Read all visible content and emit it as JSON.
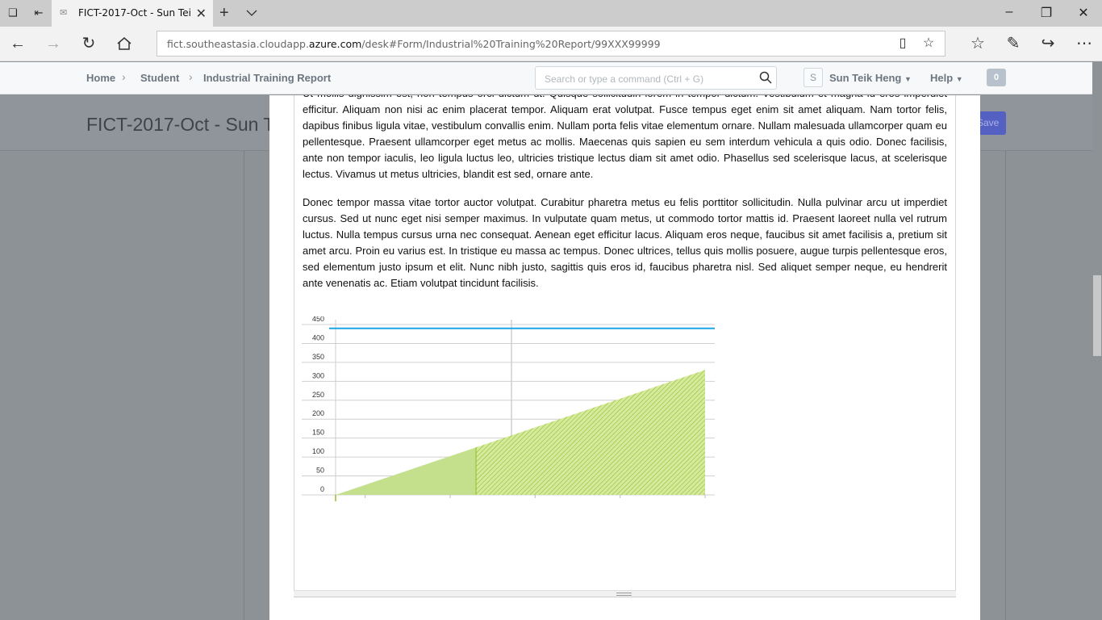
{
  "browser": {
    "tab_title": "FICT-2017-Oct - Sun Tei",
    "url_prefix": "fict.southeastasia.cloudapp.",
    "url_domain": "azure.com",
    "url_path": "/desk#Form/Industrial%20Training%20Report/99XXX99999"
  },
  "header": {
    "breadcrumbs": [
      "Home",
      "Student",
      "Industrial Training Report"
    ],
    "search_placeholder": "Search or type a command (Ctrl + G)",
    "avatar_initial": "S",
    "user_name": "Sun Teik Heng",
    "help_label": "Help",
    "notification_count": "0"
  },
  "background_page": {
    "title": "FICT-2017-Oct - Sun T",
    "save_label": "Save"
  },
  "document": {
    "para1_partial": "Ut mollis dignissim est, non tempus orci dictum ut. Quisque sollicitudin lorem in tempor dictum. Vestibulum et magna id eros imperdiet efficitur. Aliquam non nisi ac enim placerat tempor. Aliquam erat volutpat. Fusce tempus eget enim sit amet aliquam. Nam tortor felis, dapibus finibus ligula vitae, vestibulum convallis enim. Nullam porta felis vitae elementum ornare. Nullam malesuada ullamcorper quam eu pellentesque. Praesent ullamcorper eget metus ac mollis. Maecenas quis sapien eu sem interdum vehicula a quis odio. Donec facilisis, ante non tempor iaculis, leo ligula luctus leo, ultricies tristique lectus diam sit amet odio. Phasellus sed scelerisque lacus, at scelerisque lectus. Vivamus ut metus ultricies, blandit est sed, ornare ante.",
    "para2": "Donec tempor massa vitae tortor auctor volutpat. Curabitur pharetra metus eu felis porttitor sollicitudin. Nulla pulvinar arcu ut imperdiet cursus. Sed ut nunc eget nisi semper maximus. In vulputate quam metus, ut commodo tortor mattis id. Praesent laoreet nulla vel rutrum luctus. Nulla tempus cursus urna nec consequat. Aenean eget efficitur lacus. Aliquam eros neque, faucibus sit amet facilisis a, pretium sit amet arcu. Proin eu varius est. In tristique eu massa ac tempus. Donec ultrices, tellus quis mollis posuere, augue turpis pellentesque eros, sed elementum justo ipsum et elit. Nunc nibh justo, sagittis quis eros id, faucibus pharetra nisl. Sed aliquet semper neque, eu hendrerit ante venenatis ac. Etiam volutpat tincidunt facilisis."
  },
  "chart_data": {
    "type": "area",
    "yticks": [
      "0",
      "50",
      "100",
      "150",
      "200",
      "250",
      "300",
      "350",
      "400",
      "450"
    ],
    "ylim": [
      0,
      450
    ],
    "xlim": [
      0,
      100
    ],
    "limit_line": 440,
    "area_points": [
      [
        0,
        0
      ],
      [
        100,
        330
      ]
    ],
    "solid_until_x": 38,
    "x_tick_positions": [
      8,
      31,
      54,
      77,
      100
    ],
    "grid": true,
    "colors": {
      "area": "#c5e08c",
      "hatch": "#8fbf2a",
      "limit": "#1aa6e4",
      "grid": "#d0d0d0"
    }
  }
}
